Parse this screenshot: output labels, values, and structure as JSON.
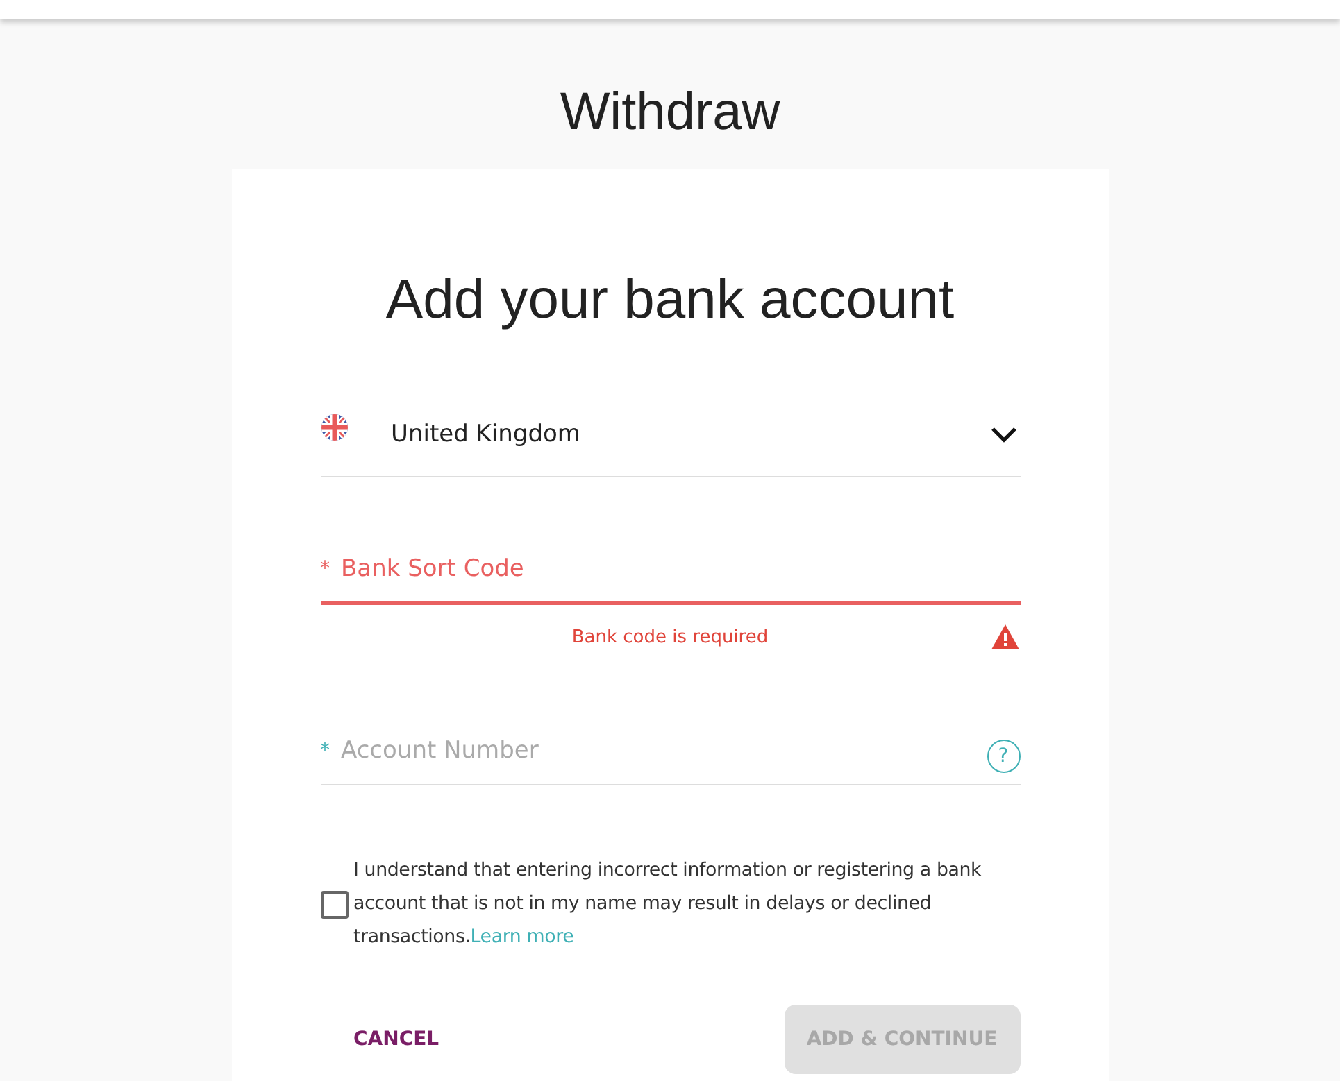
{
  "page": {
    "title": "Withdraw"
  },
  "form": {
    "heading": "Add your bank account",
    "country": {
      "value": "United Kingdom"
    },
    "fields": [
      {
        "label": "Bank Sort Code",
        "required_mark": "*",
        "error": true,
        "error_message": "Bank code is required",
        "help": false
      },
      {
        "label": "Account Number",
        "required_mark": "*",
        "error": false,
        "help": true,
        "help_glyph": "?"
      }
    ],
    "consent": {
      "checked": false,
      "text": "I understand that entering incorrect information or registering a bank account that is not in my name may result in delays or declined transactions.",
      "link": "Learn more"
    },
    "buttons": [
      {
        "label": "CANCEL",
        "kind": "text",
        "disabled": false
      },
      {
        "label": "ADD & CONTINUE",
        "kind": "primary",
        "disabled": true
      }
    ]
  }
}
